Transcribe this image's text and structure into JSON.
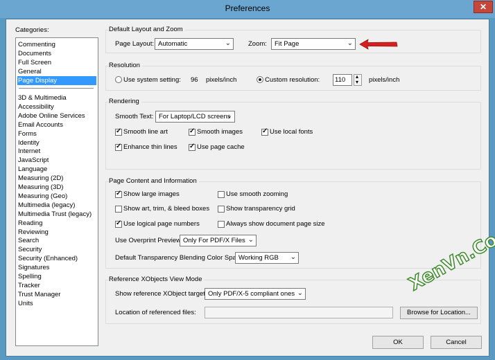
{
  "window": {
    "title": "Preferences",
    "close_glyph": "✕"
  },
  "categories": {
    "label": "Categories:",
    "items_top": [
      "Commenting",
      "Documents",
      "Full Screen",
      "General",
      "Page Display"
    ],
    "items_bottom": [
      "3D & Multimedia",
      "Accessibility",
      "Adobe Online Services",
      "Email Accounts",
      "Forms",
      "Identity",
      "Internet",
      "JavaScript",
      "Language",
      "Measuring (2D)",
      "Measuring (3D)",
      "Measuring (Geo)",
      "Multimedia (legacy)",
      "Multimedia Trust (legacy)",
      "Reading",
      "Reviewing",
      "Search",
      "Security",
      "Security (Enhanced)",
      "Signatures",
      "Spelling",
      "Tracker",
      "Trust Manager",
      "Units"
    ],
    "selected": "Page Display"
  },
  "layout_zoom": {
    "title": "Default Layout and Zoom",
    "page_layout_label": "Page Layout:",
    "page_layout_value": "Automatic",
    "zoom_label": "Zoom:",
    "zoom_value": "Fit Page"
  },
  "resolution": {
    "title": "Resolution",
    "use_system_label": "Use system setting:",
    "system_value": "96",
    "system_unit": "pixels/inch",
    "custom_label": "Custom resolution:",
    "custom_value": "110",
    "custom_unit": "pixels/inch",
    "selected": "custom"
  },
  "rendering": {
    "title": "Rendering",
    "smooth_text_label": "Smooth Text:",
    "smooth_text_value": "For Laptop/LCD screens",
    "smooth_line_art": {
      "label": "Smooth line art",
      "checked": true
    },
    "smooth_images": {
      "label": "Smooth images",
      "checked": true
    },
    "use_local_fonts": {
      "label": "Use local fonts",
      "checked": true
    },
    "enhance_thin_lines": {
      "label": "Enhance thin lines",
      "checked": true
    },
    "use_page_cache": {
      "label": "Use page cache",
      "checked": true
    }
  },
  "page_content": {
    "title": "Page Content and Information",
    "show_large_images": {
      "label": "Show large images",
      "checked": true
    },
    "use_smooth_zooming": {
      "label": "Use smooth zooming",
      "checked": false
    },
    "show_art_trim": {
      "label": "Show art, trim, & bleed boxes",
      "checked": false
    },
    "show_transparency_grid": {
      "label": "Show transparency grid",
      "checked": false
    },
    "use_logical_page_numbers": {
      "label": "Use logical page numbers",
      "checked": true
    },
    "always_show_doc_page_size": {
      "label": "Always show document page size",
      "checked": false
    },
    "overprint_label": "Use Overprint Preview:",
    "overprint_value": "Only For PDF/X Files",
    "blending_label": "Default Transparency Blending Color Space:",
    "blending_value": "Working RGB"
  },
  "xobjects": {
    "title": "Reference XObjects View Mode",
    "show_targets_label": "Show reference XObject targets:",
    "show_targets_value": "Only PDF/X-5 compliant ones",
    "location_label": "Location of referenced files:",
    "location_value": "",
    "browse_label": "Browse for Location..."
  },
  "footer": {
    "ok_label": "OK",
    "cancel_label": "Cancel"
  },
  "glyphs": {
    "check": "✓",
    "dropdown_arrow": "⌄",
    "spin_up": "▴",
    "spin_down": "▾"
  },
  "watermark": {
    "text": "XenVn.Com"
  },
  "colors": {
    "selection": "#3399ff",
    "arrow": "#d42020",
    "title_bar": "#6aa6cf",
    "watermark_green": "#3d8c2c"
  }
}
